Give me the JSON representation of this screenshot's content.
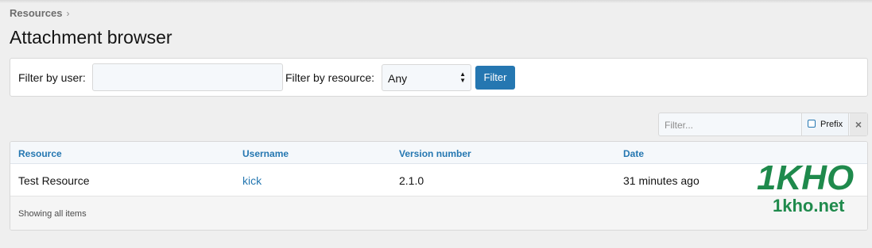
{
  "breadcrumb": {
    "label": "Resources",
    "chevron": "›"
  },
  "page": {
    "title": "Attachment browser"
  },
  "filters": {
    "user_label": "Filter by user:",
    "user_value": "",
    "resource_label": "Filter by resource:",
    "resource_selected": "Any",
    "submit_label": "Filter"
  },
  "quick_filter": {
    "placeholder": "Filter...",
    "prefix_label": "Prefix",
    "clear_icon": "×"
  },
  "table": {
    "columns": [
      "Resource",
      "Username",
      "Version number",
      "Date"
    ],
    "rows": [
      {
        "resource": "Test Resource",
        "username": "kick",
        "version": "2.1.0",
        "date": "31 minutes ago"
      }
    ],
    "footer": "Showing all items"
  },
  "watermark": {
    "logo_text": "1KHO",
    "site": "1kho.net",
    "color": "#1f8a4c"
  },
  "colors": {
    "accent": "#2577b1",
    "background": "#efefef"
  }
}
